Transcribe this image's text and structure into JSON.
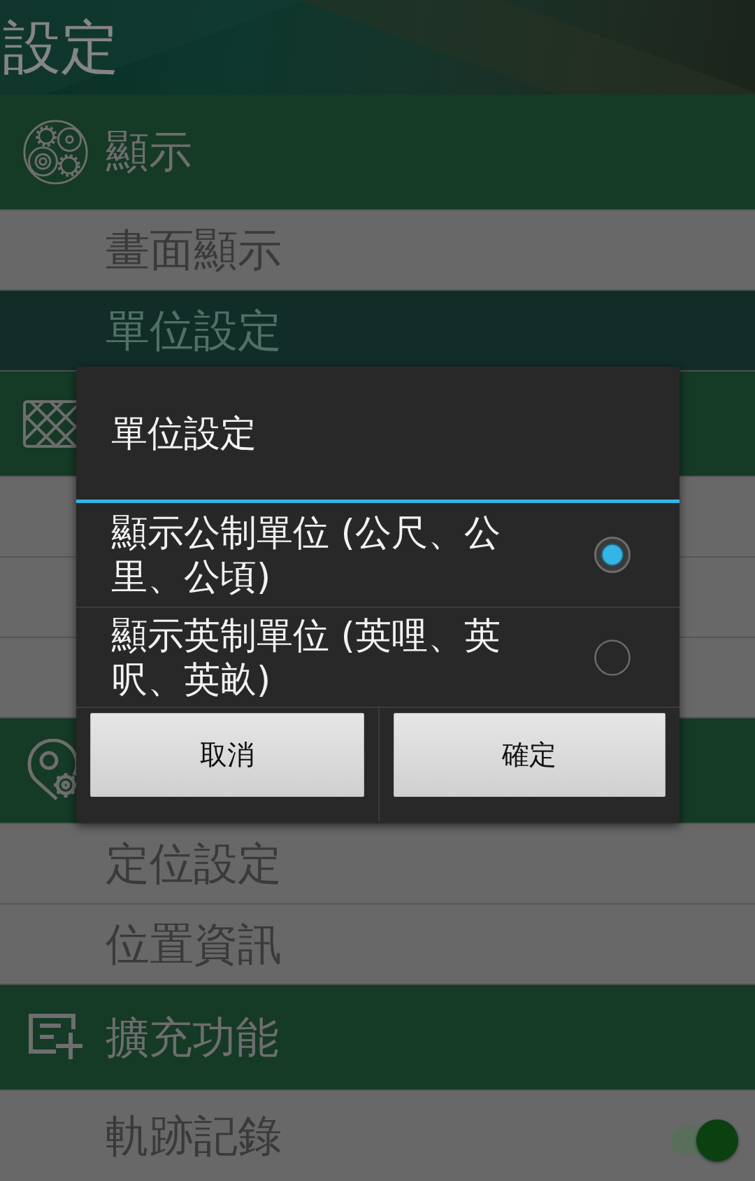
{
  "header": {
    "title": "設定"
  },
  "sections": [
    {
      "title": "顯示",
      "items": [
        {
          "kind": "plain",
          "label": "畫面顯示",
          "selected": false
        },
        {
          "kind": "plain",
          "label": "單位設定",
          "selected": true
        }
      ]
    },
    {
      "items": [
        {
          "kind": "plain",
          "selected": false
        },
        {
          "kind": "plain",
          "selected": false
        },
        {
          "kind": "plain",
          "selected": false
        }
      ]
    },
    {
      "items": [
        {
          "kind": "plain",
          "label": "定位設定",
          "selected": false
        },
        {
          "kind": "plain",
          "label": "位置資訊",
          "selected": false
        }
      ]
    },
    {
      "title": "擴充功能",
      "items": [
        {
          "kind": "switch",
          "label": "軌跡記錄",
          "selected": false,
          "on": true
        }
      ]
    }
  ],
  "dialog": {
    "title": "單位設定",
    "options": [
      {
        "label": "顯示公制單位 (公尺、公里、公頃)",
        "selected": true
      },
      {
        "label": "顯示英制單位 (英哩、英呎、英畝)",
        "selected": false
      }
    ],
    "buttons": [
      "取消",
      "確定"
    ]
  }
}
